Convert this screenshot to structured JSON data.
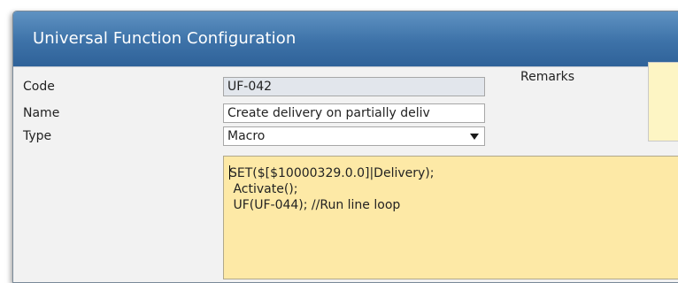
{
  "window": {
    "title": "Universal Function Configuration"
  },
  "form": {
    "code_label": "Code",
    "code_value": "UF-042",
    "name_label": "Name",
    "name_value": "Create delivery on partially deliv",
    "type_label": "Type",
    "type_value": "Macro",
    "remarks_label": "Remarks",
    "remarks_value": ""
  },
  "macro": {
    "lines": [
      "SET($[$10000329.0.0]|Delivery);",
      " Activate();",
      " UF(UF-044); //Run line loop"
    ]
  },
  "colors": {
    "titlebar": "#3d72a8",
    "code_background": "#fde9a6",
    "remarks_background": "#fdf5c4",
    "readonly_field": "#e2e6ec"
  }
}
